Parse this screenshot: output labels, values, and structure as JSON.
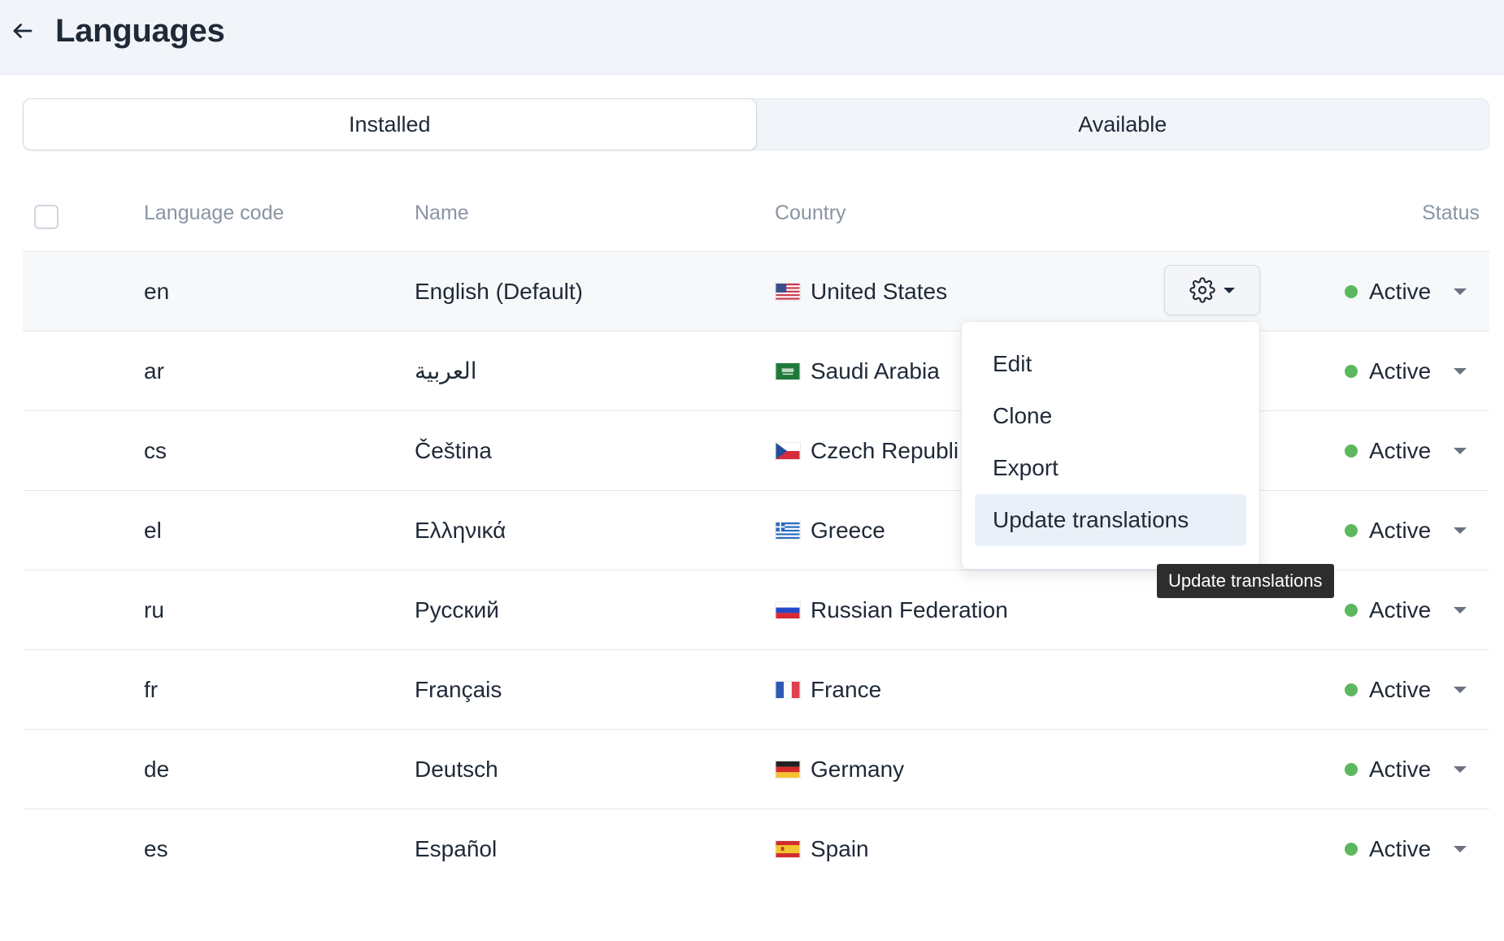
{
  "header": {
    "title": "Languages"
  },
  "tabs": [
    {
      "label": "Installed",
      "active": true
    },
    {
      "label": "Available",
      "active": false
    }
  ],
  "table": {
    "columns": {
      "code": "Language code",
      "name": "Name",
      "country": "Country",
      "status": "Status"
    },
    "rows": [
      {
        "code": "en",
        "name": "English (Default)",
        "country": "United States",
        "flag": "us",
        "status": "Active"
      },
      {
        "code": "ar",
        "name": "العربية",
        "country": "Saudi Arabia",
        "flag": "sa",
        "status": "Active"
      },
      {
        "code": "cs",
        "name": "Čeština",
        "country": "Czech Republi",
        "flag": "cz",
        "status": "Active"
      },
      {
        "code": "el",
        "name": "Ελληνικά",
        "country": "Greece",
        "flag": "gr",
        "status": "Active"
      },
      {
        "code": "ru",
        "name": "Русский",
        "country": "Russian Federation",
        "flag": "ru",
        "status": "Active"
      },
      {
        "code": "fr",
        "name": "Français",
        "country": "France",
        "flag": "fr",
        "status": "Active"
      },
      {
        "code": "de",
        "name": "Deutsch",
        "country": "Germany",
        "flag": "de",
        "status": "Active"
      },
      {
        "code": "es",
        "name": "Español",
        "country": "Spain",
        "flag": "es",
        "status": "Active"
      }
    ]
  },
  "actions_menu": {
    "items": [
      {
        "label": "Edit"
      },
      {
        "label": "Clone"
      },
      {
        "label": "Export"
      },
      {
        "label": "Update translations"
      }
    ],
    "hovered_index": 3
  },
  "tooltip": {
    "text": "Update translations"
  },
  "icons": {
    "back": "arrow-left-icon",
    "gear": "gear-icon",
    "caret": "caret-down-icon"
  },
  "colors": {
    "status_active": "#5cb85c",
    "header_bg": "#f1f4f8",
    "menu_hover": "#eaf0f8",
    "tooltip_bg": "#2d2d2d"
  }
}
